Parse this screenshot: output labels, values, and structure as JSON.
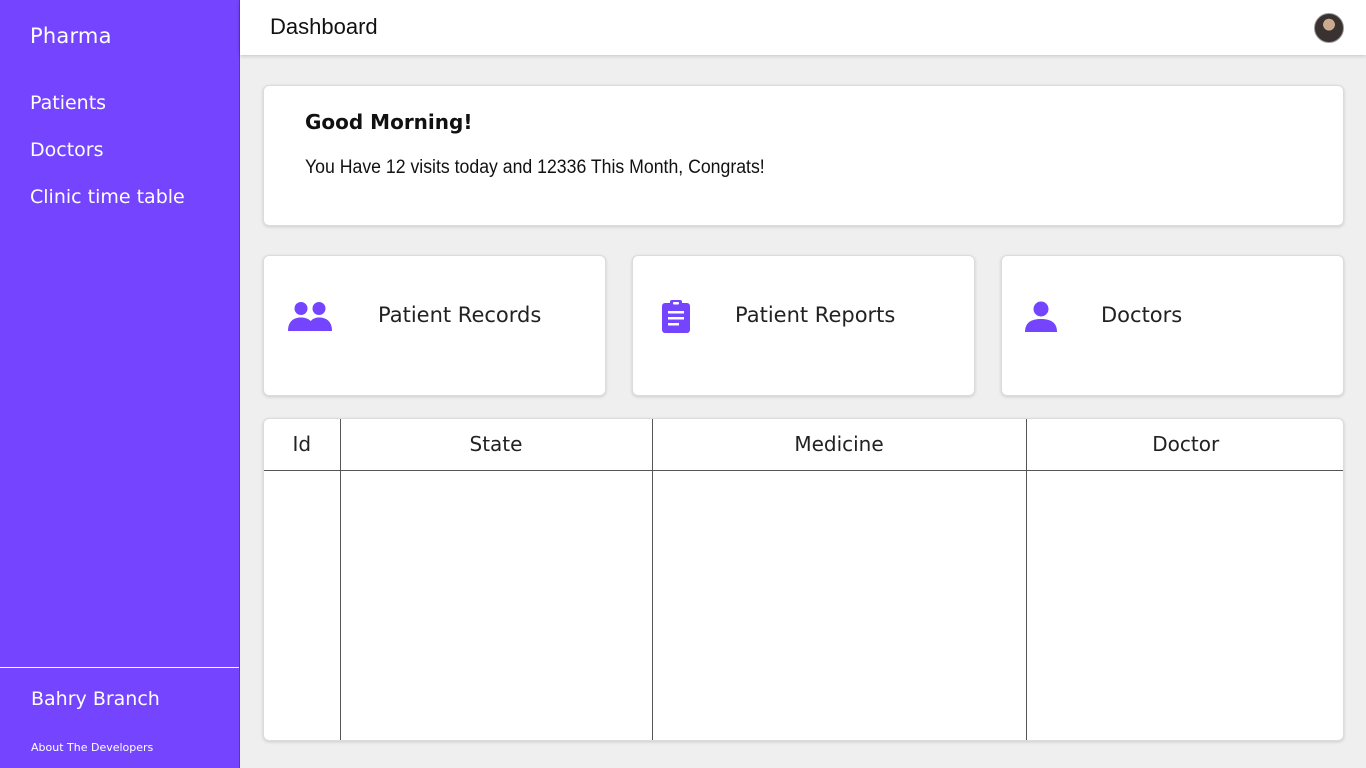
{
  "sidebar": {
    "brand": "Pharma",
    "items": [
      {
        "label": "Patients"
      },
      {
        "label": "Doctors"
      },
      {
        "label": "Clinic time table"
      }
    ],
    "branch": "Bahry Branch",
    "about": "About The Developers"
  },
  "header": {
    "title": "Dashboard",
    "avatar_icon": "user-avatar"
  },
  "greeting": {
    "title": "Good Morning!",
    "message": "You Have 12 visits today and 12336 This Month, Congrats!"
  },
  "cards": [
    {
      "label": "Patient Records",
      "icon": "group-icon"
    },
    {
      "label": "Patient Reports",
      "icon": "clipboard-icon"
    },
    {
      "label": "Doctors",
      "icon": "person-icon"
    }
  ],
  "table": {
    "columns": [
      "Id",
      "State",
      "Medicine",
      "Doctor"
    ],
    "rows": []
  },
  "colors": {
    "accent": "#7444ff",
    "background": "#efefef",
    "card": "#ffffff"
  }
}
